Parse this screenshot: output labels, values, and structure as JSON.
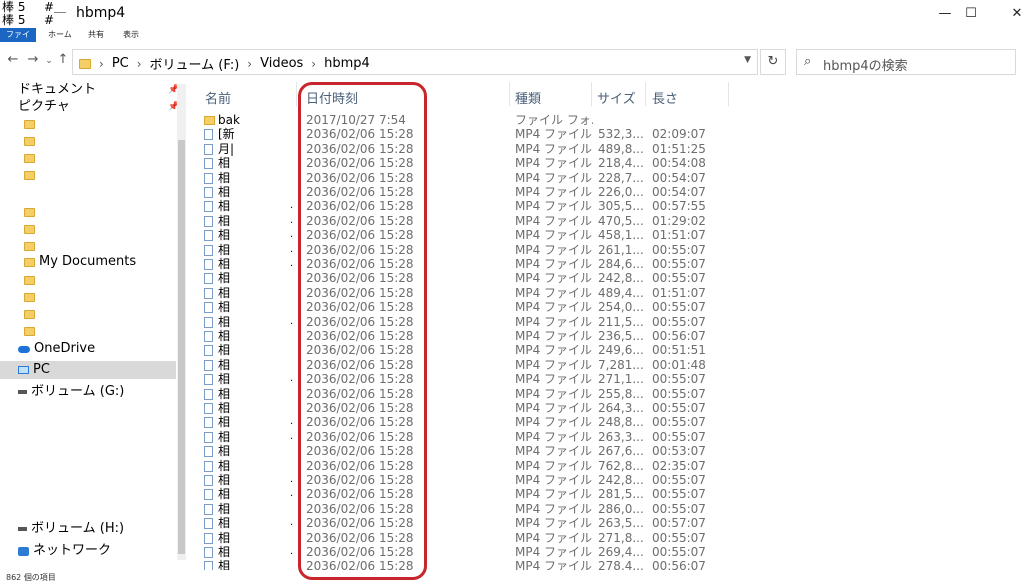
{
  "titlebar": {
    "qa_line1": "棒 5",
    "qa_line2": "棒 5",
    "qa_hash1": "#＿",
    "qa_hash2": "#",
    "title": "hbmp4",
    "minimize": "—",
    "maximize": "☐",
    "close": "✕"
  },
  "ribbon": {
    "file": "ファイル",
    "home": "ホーム",
    "share": "共有",
    "view": "表示"
  },
  "nav": {
    "back": "←",
    "forward": "→",
    "recent": "⌄",
    "up": "↑"
  },
  "address": {
    "sep": "›",
    "crumbs": [
      "PC",
      "ボリューム (F:)",
      "Videos",
      "hbmp4"
    ],
    "dropdown": "▼",
    "refresh": "↻"
  },
  "search": {
    "icon": "⌕",
    "placeholder": "hbmp4の検索"
  },
  "sidebar": {
    "pin": "📌",
    "documents": "ドキュメント",
    "pictures": "ピクチャ",
    "my_documents": "My Documents",
    "onedrive": "OneDrive",
    "pc": "PC",
    "volume_g": "ボリューム (G:)",
    "volume_h": "ボリューム (H:)",
    "network": "ネットワーク"
  },
  "columns": {
    "name": "名前",
    "date": "日付時刻",
    "type": "種類",
    "size": "サイズ",
    "length": "長さ"
  },
  "files": [
    {
      "name": "bak",
      "date": "2017/10/27 7:54",
      "type": "ファイル フォ...",
      "size": "",
      "length": "",
      "folder": true
    },
    {
      "name": "[新",
      "date": "2036/02/06 15:28",
      "type": "MP4 ファイル",
      "size": "532,3...",
      "length": "02:09:07"
    },
    {
      "name": "月|",
      "date": "2036/02/06 15:28",
      "type": "MP4 ファイル",
      "size": "489,8...",
      "length": "01:51:25"
    },
    {
      "name": "相",
      "date": "2036/02/06 15:28",
      "type": "MP4 ファイル",
      "size": "218,4...",
      "length": "00:54:08"
    },
    {
      "name": "相",
      "date": "2036/02/06 15:28",
      "type": "MP4 ファイル",
      "size": "228,7...",
      "length": "00:54:07"
    },
    {
      "name": "相",
      "date": "2036/02/06 15:28",
      "type": "MP4 ファイル",
      "size": "226,0...",
      "length": "00:54:07"
    },
    {
      "name": "相",
      "date": "2036/02/06 15:28",
      "type": "MP4 ファイル",
      "size": "305,5...",
      "length": "00:57:55"
    },
    {
      "name": "相",
      "date": "2036/02/06 15:28",
      "type": "MP4 ファイル",
      "size": "470,5...",
      "length": "01:29:02"
    },
    {
      "name": "相",
      "date": "2036/02/06 15:28",
      "type": "MP4 ファイル",
      "size": "458,1...",
      "length": "01:51:07"
    },
    {
      "name": "相",
      "date": "2036/02/06 15:28",
      "type": "MP4 ファイル",
      "size": "261,1...",
      "length": "00:55:07"
    },
    {
      "name": "相",
      "date": "2036/02/06 15:28",
      "type": "MP4 ファイル",
      "size": "284,6...",
      "length": "00:55:07"
    },
    {
      "name": "相",
      "date": "2036/02/06 15:28",
      "type": "MP4 ファイル",
      "size": "242,8...",
      "length": "00:55:07"
    },
    {
      "name": "相",
      "date": "2036/02/06 15:28",
      "type": "MP4 ファイル",
      "size": "489,4...",
      "length": "01:51:07"
    },
    {
      "name": "相",
      "date": "2036/02/06 15:28",
      "type": "MP4 ファイル",
      "size": "254,0...",
      "length": "00:55:07"
    },
    {
      "name": "相",
      "date": "2036/02/06 15:28",
      "type": "MP4 ファイル",
      "size": "211,5...",
      "length": "00:55:07"
    },
    {
      "name": "相",
      "date": "2036/02/06 15:28",
      "type": "MP4 ファイル",
      "size": "236,5...",
      "length": "00:56:07"
    },
    {
      "name": "相",
      "date": "2036/02/06 15:28",
      "type": "MP4 ファイル",
      "size": "249,6...",
      "length": "00:51:51"
    },
    {
      "name": "相",
      "date": "2036/02/06 15:28",
      "type": "MP4 ファイル",
      "size": "7,281...",
      "length": "00:01:48"
    },
    {
      "name": "相",
      "date": "2036/02/06 15:28",
      "type": "MP4 ファイル",
      "size": "271,1...",
      "length": "00:55:07"
    },
    {
      "name": "相",
      "date": "2036/02/06 15:28",
      "type": "MP4 ファイル",
      "size": "255,8...",
      "length": "00:55:07"
    },
    {
      "name": "相",
      "date": "2036/02/06 15:28",
      "type": "MP4 ファイル",
      "size": "264,3...",
      "length": "00:55:07"
    },
    {
      "name": "相",
      "date": "2036/02/06 15:28",
      "type": "MP4 ファイル",
      "size": "248,8...",
      "length": "00:55:07"
    },
    {
      "name": "相",
      "date": "2036/02/06 15:28",
      "type": "MP4 ファイル",
      "size": "263,3...",
      "length": "00:55:07"
    },
    {
      "name": "相",
      "date": "2036/02/06 15:28",
      "type": "MP4 ファイル",
      "size": "267,6...",
      "length": "00:53:07"
    },
    {
      "name": "相",
      "date": "2036/02/06 15:28",
      "type": "MP4 ファイル",
      "size": "762,8...",
      "length": "02:35:07"
    },
    {
      "name": "相",
      "date": "2036/02/06 15:28",
      "type": "MP4 ファイル",
      "size": "242,8...",
      "length": "00:55:07"
    },
    {
      "name": "相",
      "date": "2036/02/06 15:28",
      "type": "MP4 ファイル",
      "size": "281,5...",
      "length": "00:55:07"
    },
    {
      "name": "相",
      "date": "2036/02/06 15:28",
      "type": "MP4 ファイル",
      "size": "286,0...",
      "length": "00:55:07"
    },
    {
      "name": "相",
      "date": "2036/02/06 15:28",
      "type": "MP4 ファイル",
      "size": "263,5...",
      "length": "00:57:07"
    },
    {
      "name": "相",
      "date": "2036/02/06 15:28",
      "type": "MP4 ファイル",
      "size": "271,8...",
      "length": "00:55:07"
    },
    {
      "name": "相",
      "date": "2036/02/06 15:28",
      "type": "MP4 ファイル",
      "size": "269,4...",
      "length": "00:55:07"
    },
    {
      "name": "相",
      "date": "2036/02/06 15:28",
      "type": "MP4 ファイル",
      "size": "278,4...",
      "length": "00:56:07"
    }
  ],
  "status": {
    "count": "862 個の項目"
  }
}
